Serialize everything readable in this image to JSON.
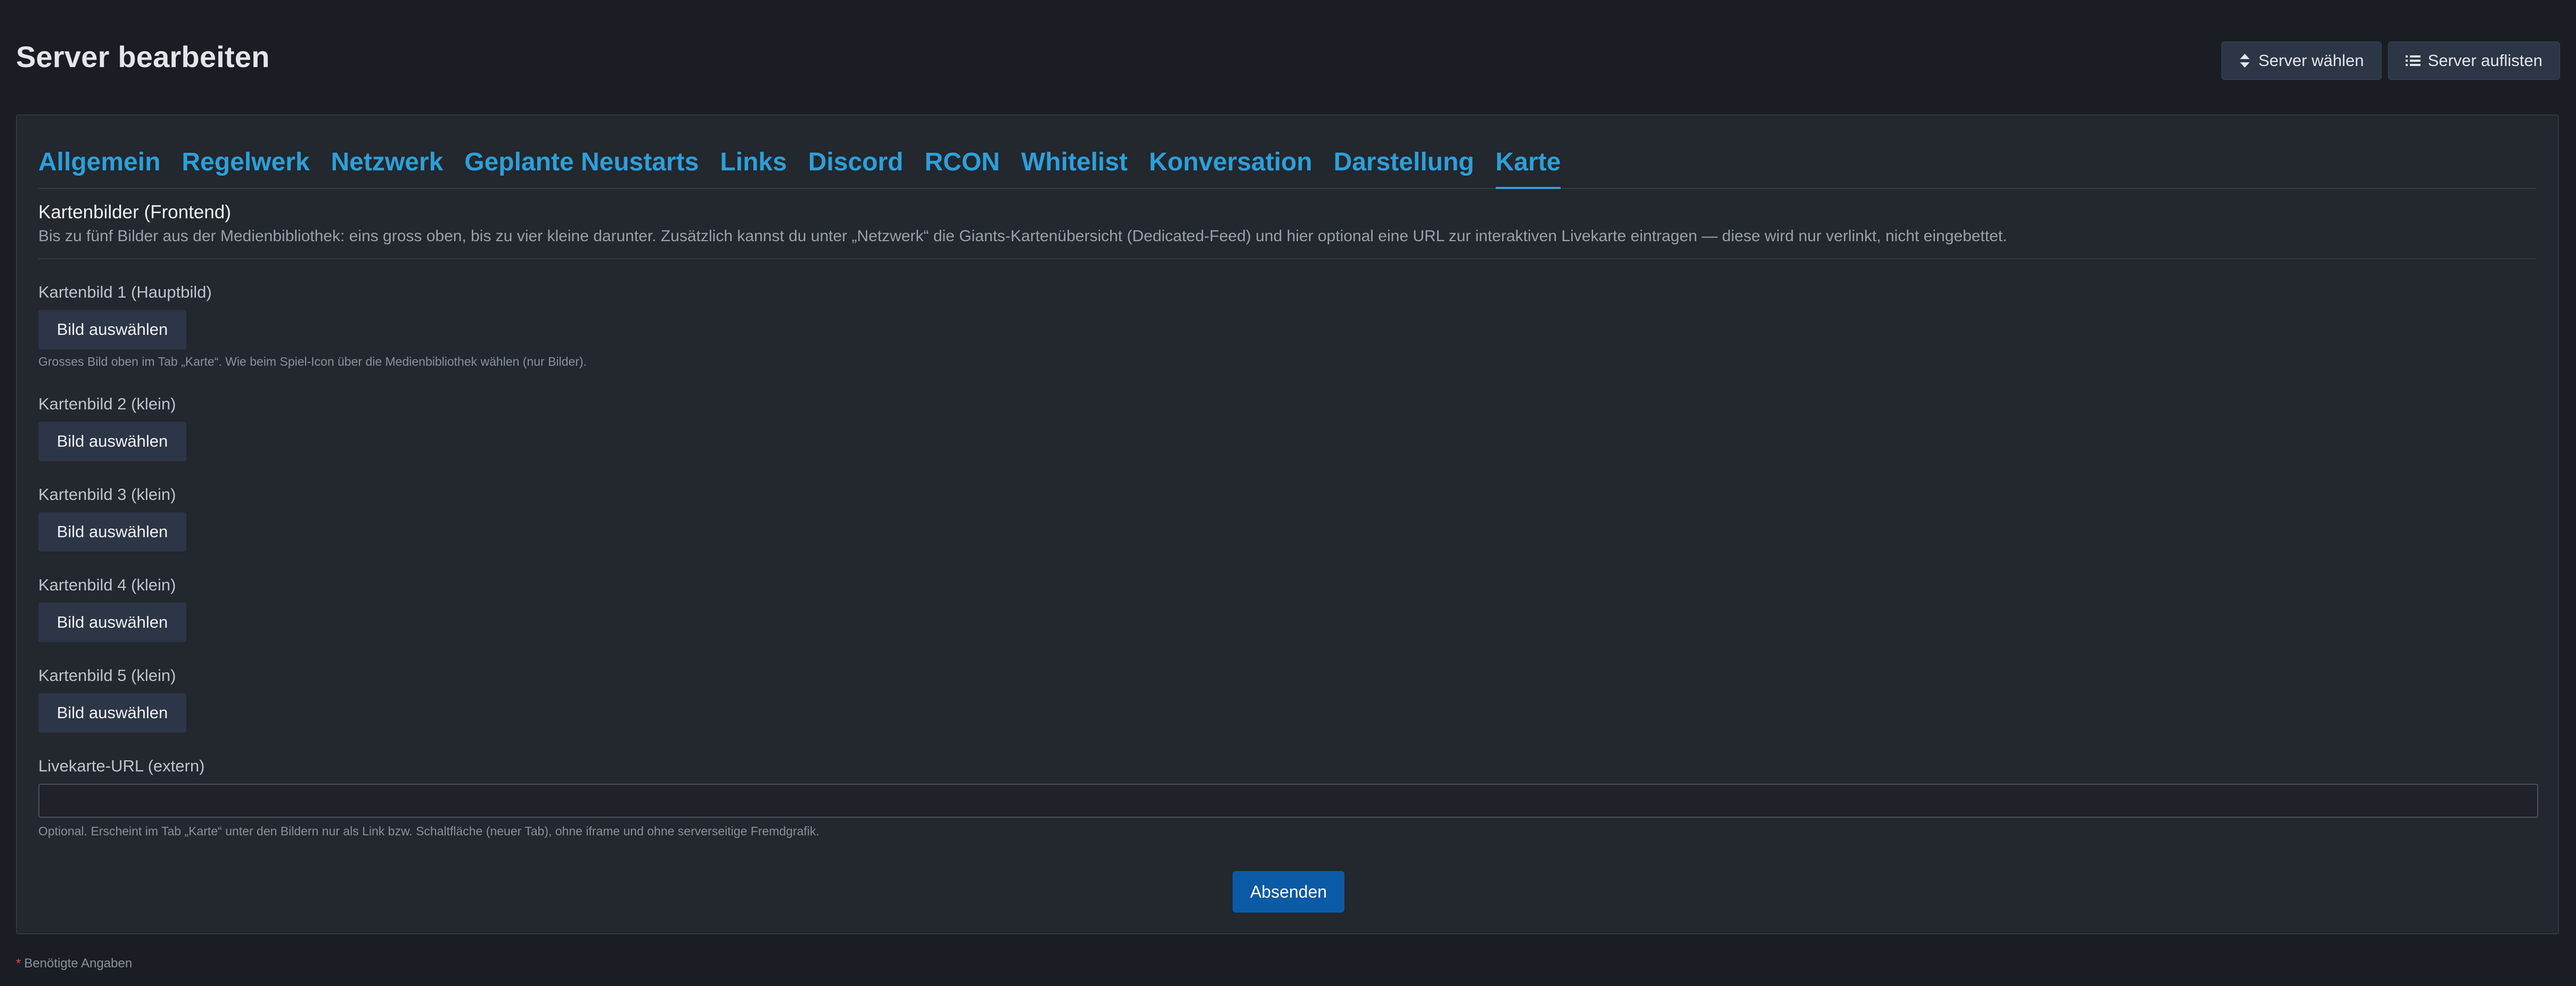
{
  "header": {
    "title": "Server bearbeiten",
    "buttons": {
      "select_server": "Server wählen",
      "list_servers": "Server auflisten"
    }
  },
  "icons": {
    "select_server": "sort-arrows-icon",
    "list_servers": "list-icon"
  },
  "tabs": [
    {
      "label": "Allgemein",
      "active": false
    },
    {
      "label": "Regelwerk",
      "active": false
    },
    {
      "label": "Netzwerk",
      "active": false
    },
    {
      "label": "Geplante Neustarts",
      "active": false
    },
    {
      "label": "Links",
      "active": false
    },
    {
      "label": "Discord",
      "active": false
    },
    {
      "label": "RCON",
      "active": false
    },
    {
      "label": "Whitelist",
      "active": false
    },
    {
      "label": "Konversation",
      "active": false
    },
    {
      "label": "Darstellung",
      "active": false
    },
    {
      "label": "Karte",
      "active": true
    }
  ],
  "section": {
    "title": "Kartenbilder (Frontend)",
    "description": "Bis zu fünf Bilder aus der Medienbibliothek: eins gross oben, bis zu vier kleine darunter. Zusätzlich kannst du unter „Netzwerk“ die Giants-Kartenübersicht (Dedicated-Feed) und hier optional eine URL zur interaktiven Livekarte eintragen — diese wird nur verlinkt, nicht eingebettet."
  },
  "images": [
    {
      "label": "Kartenbild 1 (Hauptbild)",
      "button": "Bild auswählen",
      "help": "Grosses Bild oben im Tab „Karte“. Wie beim Spiel-Icon über die Medienbibliothek wählen (nur Bilder)."
    },
    {
      "label": "Kartenbild 2 (klein)",
      "button": "Bild auswählen"
    },
    {
      "label": "Kartenbild 3 (klein)",
      "button": "Bild auswählen"
    },
    {
      "label": "Kartenbild 4 (klein)",
      "button": "Bild auswählen"
    },
    {
      "label": "Kartenbild 5 (klein)",
      "button": "Bild auswählen"
    }
  ],
  "livemap": {
    "label": "Livekarte-URL (extern)",
    "value": "",
    "placeholder": "",
    "help": "Optional. Erscheint im Tab „Karte“ unter den Bildern nur als Link bzw. Schaltfläche (neuer Tab), ohne iframe und ohne serverseitige Fremdgrafik."
  },
  "submit_label": "Absenden",
  "footnote": {
    "star": "*",
    "text": "Benötigte Angaben"
  },
  "colors": {
    "accent": "#2e9fd8",
    "submit": "#0b5aa6",
    "required": "#e04b4b"
  }
}
